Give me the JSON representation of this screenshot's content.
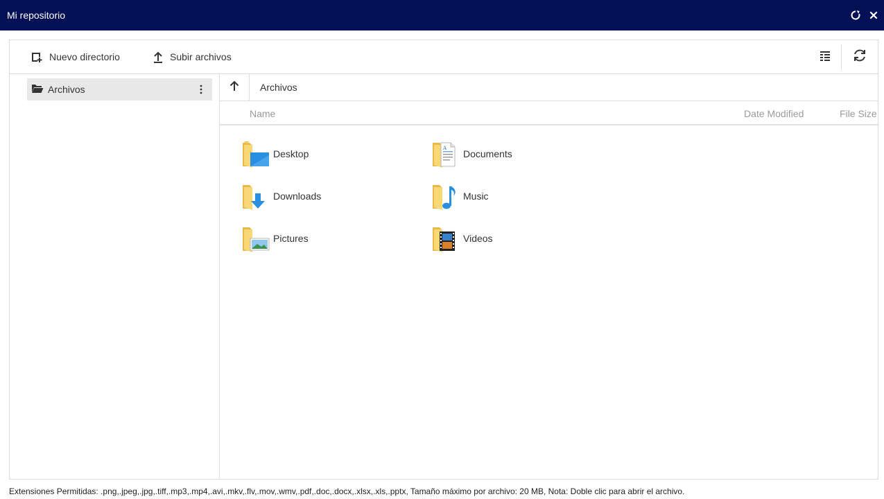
{
  "window": {
    "title": "Mi repositorio"
  },
  "toolbar": {
    "new_folder_label": "Nuevo directorio",
    "upload_label": "Subir archivos"
  },
  "navigation": {
    "items": [
      {
        "label": "Archivos",
        "icon": "folder-open-icon",
        "selected": true
      }
    ]
  },
  "address": {
    "breadcrumb": "Archivos"
  },
  "columns": {
    "name": "Name",
    "date_modified": "Date Modified",
    "file_size": "File Size"
  },
  "files": [
    {
      "name": "Desktop",
      "icon": "desktop-folder-icon"
    },
    {
      "name": "Documents",
      "icon": "documents-folder-icon"
    },
    {
      "name": "Downloads",
      "icon": "downloads-folder-icon"
    },
    {
      "name": "Music",
      "icon": "music-folder-icon"
    },
    {
      "name": "Pictures",
      "icon": "pictures-folder-icon"
    },
    {
      "name": "Videos",
      "icon": "videos-folder-icon"
    }
  ],
  "footer": {
    "note": "Extensiones Permitidas: .png,.jpeg,.jpg,.tiff,.mp3,.mp4,.avi,.mkv,.flv,.mov,.wmv,.pdf,.doc,.docx,.xlsx,.xls,.pptx, Tamaño máximo por archivo: 20 MB, Nota: Doble clic para abrir el archivo."
  },
  "colors": {
    "titlebar_bg": "#041055",
    "selected_nav_bg": "#e8e8e8",
    "folder_yellow": "#f8d775",
    "accent_blue": "#2b8fe0"
  }
}
